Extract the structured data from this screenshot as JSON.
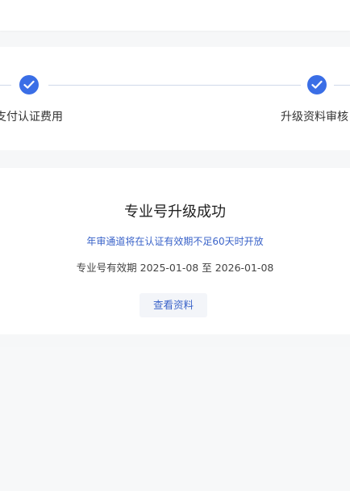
{
  "steps": [
    {
      "label": "支付认证费用",
      "status": "completed"
    },
    {
      "label": "升级资料审核",
      "status": "completed"
    }
  ],
  "result": {
    "title": "专业号升级成功",
    "notice": "年审通道将在认证有效期不足60天时开放",
    "validity": "专业号有效期 2025-01-08 至 2026-01-08",
    "view_button": "查看资料"
  },
  "colors": {
    "accent": "#3a6ee6",
    "link": "#3a63c9",
    "page_bg": "#f6f7f8"
  },
  "icons": {
    "step_done": "check-circle-icon"
  }
}
